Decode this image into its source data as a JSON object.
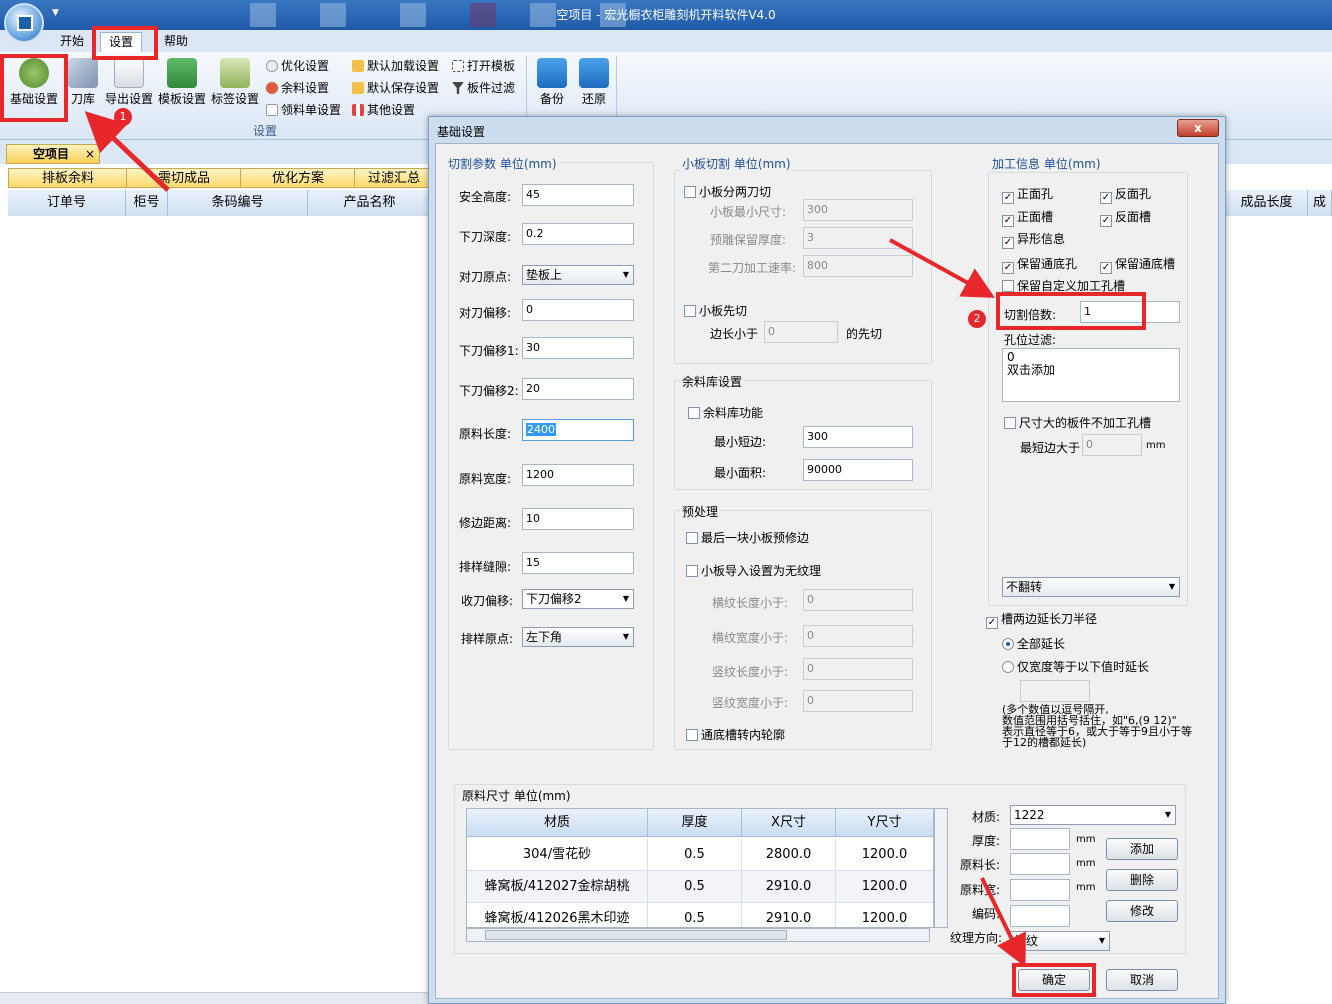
{
  "window": {
    "title": "空项目 - 宏光橱衣柜雕刻机开料软件V4.0"
  },
  "menu": {
    "tabs": [
      "开始",
      "设置",
      "帮助"
    ]
  },
  "ribbon": {
    "buttons": {
      "basic": "基础设置",
      "knife": "刀库",
      "export": "导出设置",
      "template": "模板设置",
      "label": "标签设置",
      "backup": "备份",
      "restore": "还原"
    },
    "small": {
      "optimize": "优化设置",
      "remnant": "余料设置",
      "picking": "领料单设置",
      "default_load": "默认加载设置",
      "default_save": "默认保存设置",
      "other": "其他设置",
      "open_template": "打开模板",
      "panel_filter": "板件过滤"
    },
    "group_label": "设置"
  },
  "doc": {
    "tab": "空项目",
    "close": "×",
    "subtabs": [
      "排板余料",
      "需切成品",
      "优化方案",
      "过滤汇总"
    ],
    "columns": [
      "订单号",
      "柜号",
      "条码编号",
      "产品名称",
      "成品长度",
      "成"
    ]
  },
  "annotations": {
    "step1": "1",
    "step2": "2"
  },
  "dialog": {
    "title": "基础设置",
    "close": "x",
    "cut_params": {
      "title": "切割参数 单位(mm)",
      "fields": [
        {
          "label": "安全高度:",
          "value": "45"
        },
        {
          "label": "下刀深度:",
          "value": "0.2"
        },
        {
          "label": "对刀原点:",
          "value": "垫板上"
        },
        {
          "label": "对刀偏移:",
          "value": "0"
        },
        {
          "label": "下刀偏移1:",
          "value": "30"
        },
        {
          "label": "下刀偏移2:",
          "value": "20"
        },
        {
          "label": "原料长度:",
          "value": "2400"
        },
        {
          "label": "原料宽度:",
          "value": "1200"
        },
        {
          "label": "修边距离:",
          "value": "10"
        },
        {
          "label": "排样缝隙:",
          "value": "15"
        },
        {
          "label": "收刀偏移:",
          "value": "下刀偏移2"
        },
        {
          "label": "排样原点:",
          "value": "左下角"
        }
      ]
    },
    "small_cut": {
      "title": "小板切割 单位(mm)",
      "two_cut": "小板分两刀切",
      "min_size_label": "小板最小尺寸:",
      "min_size": "300",
      "pre_thick_label": "预雕保留厚度:",
      "pre_thick": "3",
      "second_speed_label": "第二刀加工速率:",
      "second_speed": "800",
      "first_cut": "小板先切",
      "edge_less": "边长小于",
      "edge_value": "0",
      "first_suffix": "的先切"
    },
    "remnant_lib": {
      "title": "余料库设置",
      "enable": "余料库功能",
      "min_short_label": "最小短边:",
      "min_short": "300",
      "min_area_label": "最小面积:",
      "min_area": "90000"
    },
    "preprocess": {
      "title": "预处理",
      "last_trim": "最后一块小板预修边",
      "no_grain": "小板导入设置为无纹理",
      "rows": [
        {
          "label": "横纹长度小于:",
          "value": "0"
        },
        {
          "label": "横纹宽度小于:",
          "value": "0"
        },
        {
          "label": "竖纹长度小于:",
          "value": "0"
        },
        {
          "label": "竖纹宽度小于:",
          "value": "0"
        }
      ],
      "slot_contour": "通底槽转内轮廓"
    },
    "process_info": {
      "title": "加工信息 单位(mm)",
      "front_hole": "正面孔",
      "back_hole": "反面孔",
      "front_slot": "正面槽",
      "back_slot": "反面槽",
      "shaped": "异形信息",
      "keep_through_hole": "保留通底孔",
      "keep_through_slot": "保留通底槽",
      "keep_custom": "保留自定义加工孔槽",
      "cut_multiple_label": "切割倍数:",
      "cut_multiple": "1",
      "hole_filter_label": "孔位过滤:",
      "hole_filter_lines": [
        "0",
        "双击添加"
      ],
      "big_no_process": "尺寸大的板件不加工孔槽",
      "min_edge_label": "最短边大于",
      "min_edge": "0",
      "mm": "mm",
      "flip": "不翻转"
    },
    "slot_extend": {
      "label": "槽两边延长刀半径",
      "all": "全部延长",
      "width_only": "仅宽度等于以下值时延长",
      "note_lines": [
        "(多个数值以逗号隔开,",
        "数值范围用括号括住，如\"6,(9 12)\"",
        "表示直径等于6，或大于等于9且小于等",
        "于12的槽都延长)"
      ]
    },
    "raw_size": {
      "title": "原料尺寸 单位(mm)",
      "headers": [
        "材质",
        "厚度",
        "X尺寸",
        "Y尺寸"
      ],
      "rows": [
        [
          "304/雪花砂",
          "0.5",
          "2800.0",
          "1200.0"
        ],
        [
          "蜂窝板/412027金棕胡桃",
          "0.5",
          "2910.0",
          "1200.0"
        ],
        [
          "蜂窝板/412026黑木印迹",
          "0.5",
          "2910.0",
          "1200.0"
        ]
      ],
      "material_label": "材质:",
      "material": "1222",
      "thickness_label": "厚度:",
      "length_label": "原料长:",
      "width_label": "原料宽:",
      "code_label": "编码:",
      "grain_label": "纹理方向:",
      "grain": "横纹",
      "mm": "mm",
      "add": "添加",
      "delete": "删除",
      "modify": "修改"
    },
    "ok": "确定",
    "cancel": "取消"
  },
  "colors": {
    "accent_red": "#e8272b",
    "ribbon_blue": "#1e5aa8"
  }
}
